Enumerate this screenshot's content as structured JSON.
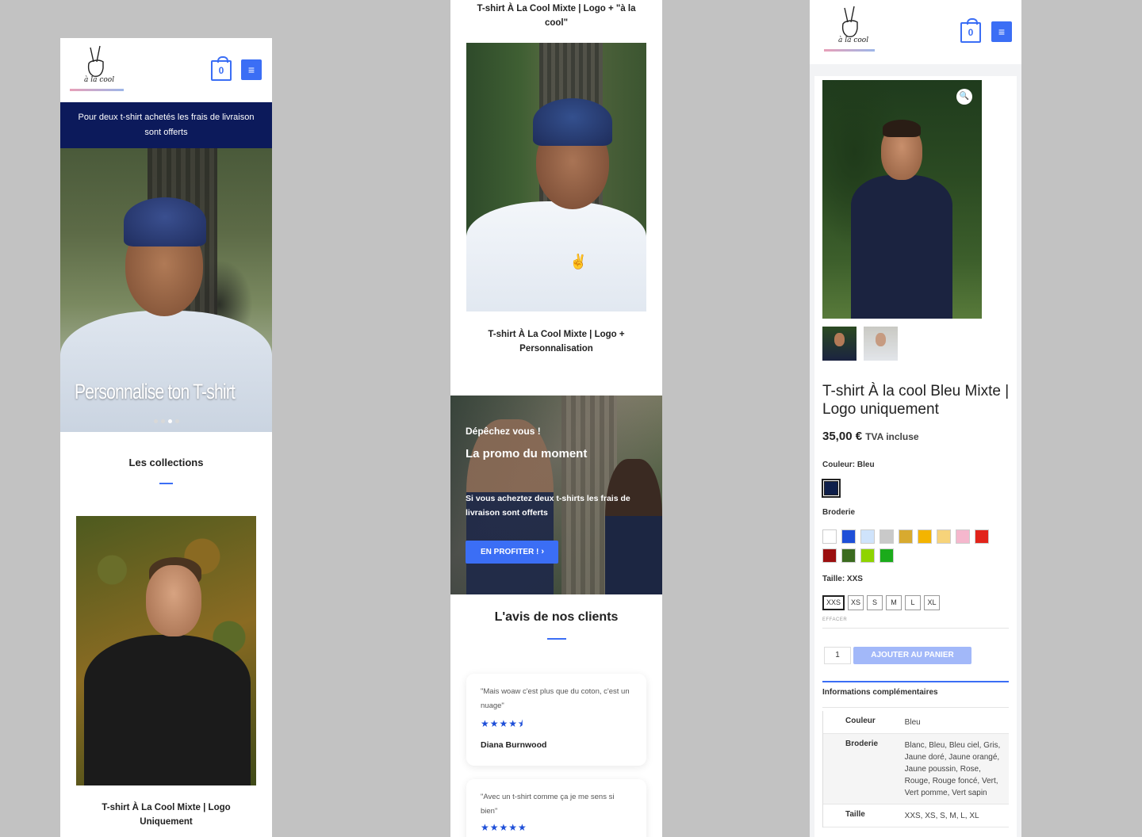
{
  "header": {
    "cart_count": "0",
    "logo_caption": "à la cool",
    "menu_icon": "hamburger-icon",
    "cart_icon": "shopping-bag-icon"
  },
  "phone1": {
    "banner": "Pour deux t-shirt achetés les frais de livraison sont offerts",
    "hero_title": "Personnalise ton T-shirt",
    "slider_dots": 4,
    "slider_active": 3,
    "collections_title": "Les collections",
    "product_name": "T-shirt À La Cool Mixte | Logo Uniquement"
  },
  "phone2": {
    "top_product_name": "T-shirt À La Cool Mixte | Logo + \"à la cool\"",
    "product_name": "T-shirt À La Cool Mixte | Logo + Personnalisation",
    "promo": {
      "kicker": "Dépêchez vous !",
      "title": "La promo du moment",
      "text": "Si vous acheztez deux t-shirts les frais de livraison sont offerts",
      "cta": "EN PROFITER !",
      "cta_icon": "chevron-right-icon"
    },
    "reviews_title": "L'avis de nos clients",
    "reviews": [
      {
        "quote": "\"Mais woaw c'est plus que du coton, c'est un nuage\"",
        "stars": "★★★★⯨",
        "rating": 4.5,
        "author": "Diana Burnwood"
      },
      {
        "quote": "\"Avec un t-shirt comme ça je me sens si bien\"",
        "stars": "★★★★★",
        "rating": 5,
        "author": ""
      }
    ]
  },
  "phone3": {
    "zoom_icon": "magnifier-icon",
    "title": "T-shirt À la cool Bleu Mixte | Logo uniquement",
    "price": "35,00 €",
    "tva": "TVA incluse",
    "color_label": "Couleur: Bleu",
    "color_swatch": "#0f1f4b",
    "embroidery_label": "Broderie",
    "embroidery_swatches": [
      "#ffffff",
      "#1e4fd8",
      "#cfe3fb",
      "#c9c9c9",
      "#d8aa2f",
      "#f4b400",
      "#f7d37a",
      "#f5b7cd",
      "#e2231a",
      "#9b0f0f",
      "#3b6b1f",
      "#8fd400",
      "#1bab1b"
    ],
    "size_label": "Taille: XXS",
    "sizes": [
      "XXS",
      "XS",
      "S",
      "M",
      "L",
      "XL"
    ],
    "selected_size": "XXS",
    "clear_label": "EFFACER",
    "quantity": "1",
    "add_to_cart": "AJOUTER AU PANIER",
    "info_title": "Informations complémentaires",
    "specs": [
      {
        "key": "Couleur",
        "value": "Bleu"
      },
      {
        "key": "Broderie",
        "value": "Blanc, Bleu, Bleu ciel, Gris, Jaune doré, Jaune orangé, Jaune poussin, Rose, Rouge, Rouge foncé, Vert, Vert pomme, Vert sapin"
      },
      {
        "key": "Taille",
        "value": "XXS, XS, S, M, L, XL"
      }
    ]
  },
  "colors": {
    "accent": "#3b6ef5",
    "banner_bg": "#0c1a5b",
    "page_bg": "#c2c2c2"
  }
}
